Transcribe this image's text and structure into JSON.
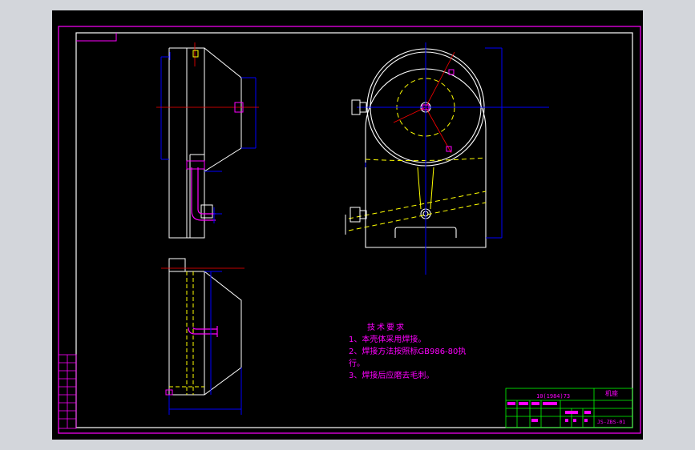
{
  "drawing": {
    "notes": {
      "title": "技术要求",
      "items": [
        "1、本壳体采用焊接。",
        "2、焊接方法按照标GB986-80执",
        "行。",
        "3、焊接后应磨去毛刺。"
      ]
    },
    "title_block": {
      "doc_code": "10(1984)73",
      "name": "机座",
      "drawing_no": "JS-ZBS-01"
    },
    "colors": {
      "background": "#000000",
      "frame": "#ffffff",
      "outer_border": "#ff00ff",
      "geometry": "#ffffff",
      "hidden_lines": "#ffff00",
      "centerlines": "#ff0000",
      "dimensions": "#0000ff",
      "annotations": "#ff00ff",
      "title_block": "#00ff00",
      "window_chrome": "#d3d6db"
    }
  }
}
